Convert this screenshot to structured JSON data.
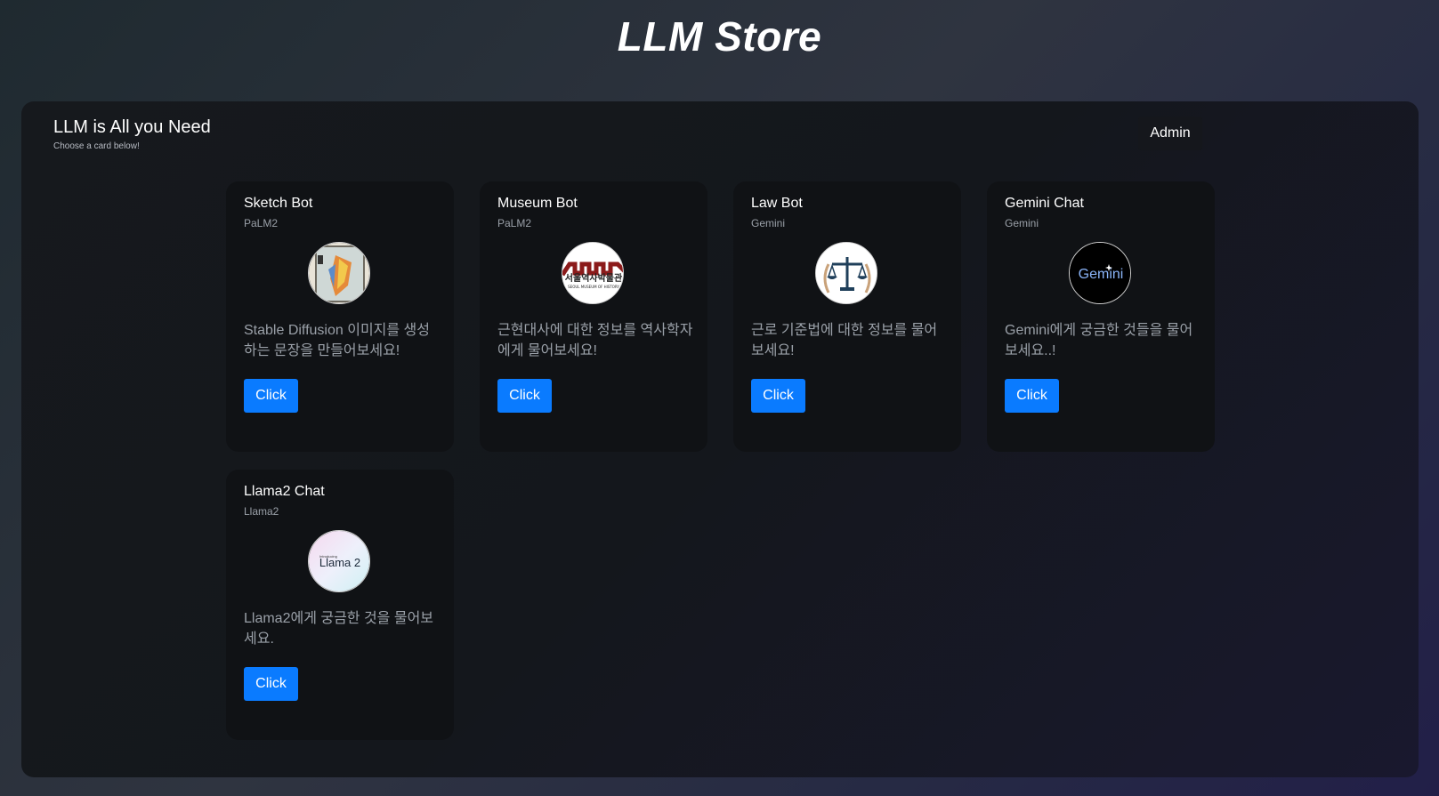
{
  "header": {
    "title": "LLM Store"
  },
  "panel": {
    "heading": "LLM is All you Need",
    "subheading": "Choose a card below!",
    "admin_label": "Admin"
  },
  "cards": [
    {
      "title": "Sketch Bot",
      "model": "PaLM2",
      "description": "Stable Diffusion 이미지를 생성하는 문장을 만들어보세요!",
      "button": "Click",
      "icon": "sketch-painting-icon"
    },
    {
      "title": "Museum Bot",
      "model": "PaLM2",
      "description": "근현대사에 대한 정보를 역사학자에게 물어보세요!",
      "button": "Click",
      "icon": "museum-logo-icon",
      "image_text": "서울역사박물관",
      "image_subtext": "SEOUL MUSEUM OF HISTORY"
    },
    {
      "title": "Law Bot",
      "model": "Gemini",
      "description": "근로 기준법에 대한 정보를 물어보세요!",
      "button": "Click",
      "icon": "scales-of-justice-icon"
    },
    {
      "title": "Gemini Chat",
      "model": "Gemini",
      "description": "Gemini에게 궁금한 것들을 물어보세요..!",
      "button": "Click",
      "icon": "gemini-logo-icon",
      "image_text": "Gemini"
    },
    {
      "title": "Llama2 Chat",
      "model": "Llama2",
      "description": "Llama2에게 궁금한 것을 물어보세요.",
      "button": "Click",
      "icon": "llama2-logo-icon",
      "image_text": "Llama 2",
      "image_subtext": "Introducing"
    }
  ]
}
